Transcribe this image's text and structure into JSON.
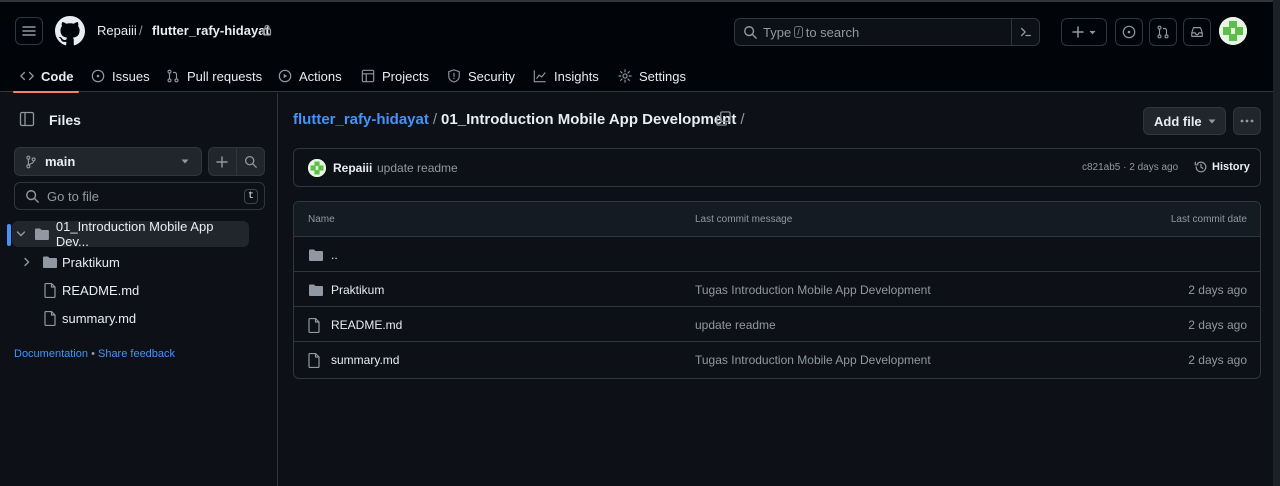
{
  "header": {
    "owner": "Repaiii",
    "separator": "/",
    "repo": "flutter_rafy-hidayat",
    "search": {
      "placeholder_before": "Type",
      "shortcut": "/",
      "placeholder_after": "to search"
    }
  },
  "tabs": [
    {
      "label": "Code",
      "icon": "code-icon"
    },
    {
      "label": "Issues",
      "icon": "issue-icon"
    },
    {
      "label": "Pull requests",
      "icon": "pull-request-icon"
    },
    {
      "label": "Actions",
      "icon": "play-icon"
    },
    {
      "label": "Projects",
      "icon": "table-icon"
    },
    {
      "label": "Security",
      "icon": "shield-icon"
    },
    {
      "label": "Insights",
      "icon": "graph-icon"
    },
    {
      "label": "Settings",
      "icon": "gear-icon"
    }
  ],
  "sidebar": {
    "title": "Files",
    "branch": "main",
    "goto_placeholder": "Go to file",
    "goto_shortcut": "t",
    "tree": [
      {
        "label": "01_Introduction Mobile App Dev...",
        "type": "folder",
        "open": true
      },
      {
        "label": "Praktikum",
        "type": "folder",
        "open": false
      },
      {
        "label": "README.md",
        "type": "file"
      },
      {
        "label": "summary.md",
        "type": "file"
      }
    ],
    "links": {
      "documentation": "Documentation",
      "bullet": "•",
      "feedback": "Share feedback"
    }
  },
  "main": {
    "path": {
      "repo": "flutter_rafy-hidayat",
      "sep": "/",
      "folder": "01_Introduction Mobile App Development",
      "trail": "/"
    },
    "add_file": "Add file",
    "commit": {
      "author": "Repaiii",
      "message": "update readme",
      "meta": "c821ab5 · 2 days ago",
      "history": "History"
    },
    "table": {
      "headers": {
        "name": "Name",
        "message": "Last commit message",
        "date": "Last commit date"
      },
      "rows": [
        {
          "name": "..",
          "message": "",
          "date": "",
          "type": "folder"
        },
        {
          "name": "Praktikum",
          "message": "Tugas Introduction Mobile App Development",
          "date": "2 days ago",
          "type": "folder"
        },
        {
          "name": "README.md",
          "message": "update readme",
          "date": "2 days ago",
          "type": "file"
        },
        {
          "name": "summary.md",
          "message": "Tugas Introduction Mobile App Development",
          "date": "2 days ago",
          "type": "file"
        }
      ]
    }
  },
  "colors": {
    "accent_link": "#4493f8",
    "tab_underline": "#f78166",
    "background": "#0d1117"
  }
}
